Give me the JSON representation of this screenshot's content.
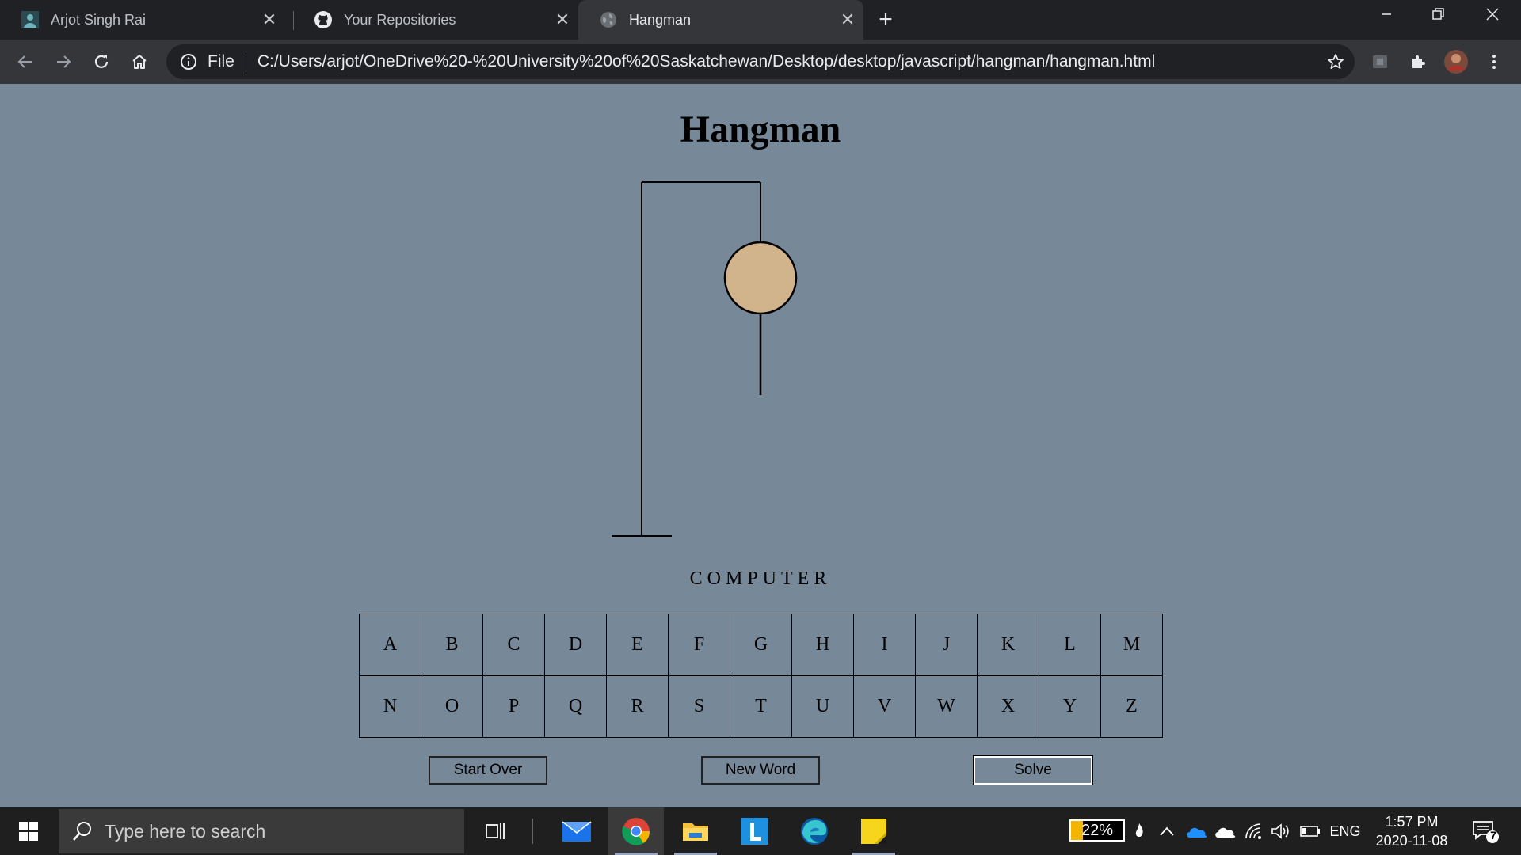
{
  "browser": {
    "tabs": [
      {
        "title": "Arjot Singh Rai",
        "icon": "portrait-favicon",
        "active": false
      },
      {
        "title": "Your Repositories",
        "icon": "github-icon",
        "active": false
      },
      {
        "title": "Hangman",
        "icon": "globe-icon",
        "active": true
      }
    ],
    "address": {
      "scheme_label": "File",
      "url": "C:/Users/arjot/OneDrive%20-%20University%20of%20Saskatchewan/Desktop/desktop/javascript/hangman/hangman.html"
    }
  },
  "page": {
    "title": "Hangman",
    "word": "COMPUTER",
    "letters_row1": [
      "A",
      "B",
      "C",
      "D",
      "E",
      "F",
      "G",
      "H",
      "I",
      "J",
      "K",
      "L",
      "M"
    ],
    "letters_row2": [
      "N",
      "O",
      "P",
      "Q",
      "R",
      "S",
      "T",
      "U",
      "V",
      "W",
      "X",
      "Y",
      "Z"
    ],
    "buttons": {
      "start_over": "Start Over",
      "new_word": "New Word",
      "solve": "Solve"
    },
    "colors": {
      "background": "#778899",
      "head_fill": "#d2b48c"
    }
  },
  "taskbar": {
    "search_placeholder": "Type here to search",
    "battery": "22%",
    "battery_level": 0.22,
    "language": "ENG",
    "time": "1:57 PM",
    "date": "2020-11-08",
    "notifications": "7"
  }
}
